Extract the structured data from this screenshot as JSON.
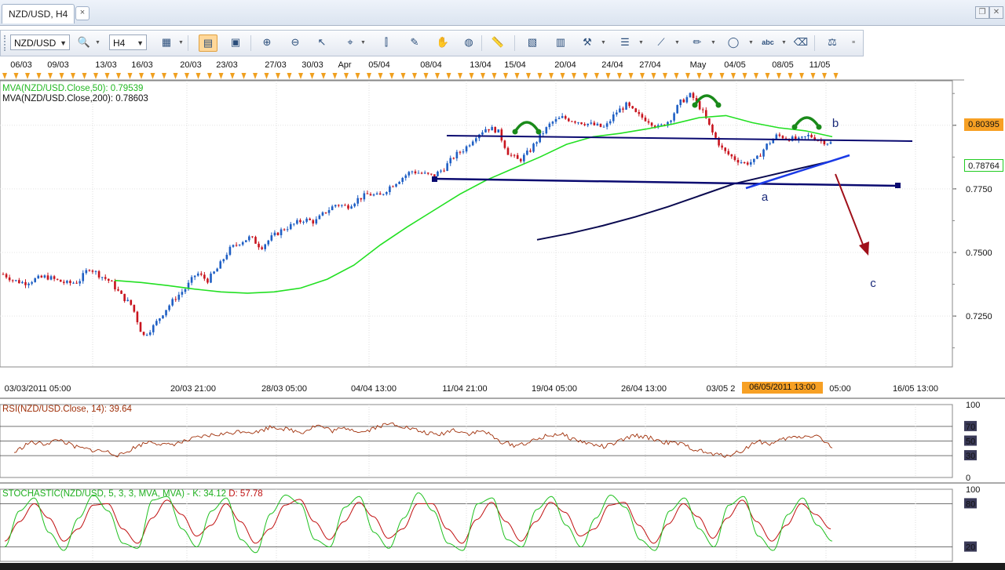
{
  "tab": {
    "title": "NZD/USD, H4",
    "close": "×"
  },
  "window_buttons": [
    "restore",
    "close"
  ],
  "toolbar": {
    "symbol": "NZD/USD",
    "timeframe": "H4",
    "icons": [
      "chart-type-icon",
      "zoom-icon",
      "bar-chart-icon",
      "text-icon",
      "magnify-plus-icon",
      "magnify-minus-icon",
      "cursor-icon",
      "crosshair-icon",
      "indicator-icon",
      "edit-icon",
      "hand-icon",
      "globe-icon",
      "ruler-icon",
      "image-icon",
      "screenshot-icon",
      "tools-icon",
      "layers-icon",
      "trendline-icon",
      "pencil-icon",
      "ellipse-icon",
      "text-abc-icon",
      "eraser-icon",
      "objects-icon"
    ]
  },
  "colors": {
    "up": "#1f5fc4",
    "down": "#c8141e",
    "ma50": "#22e022",
    "ma200": "#0a0a50",
    "trend": "#0a0a70",
    "wedge": "#1a3ae6",
    "arrow": "#a0101a",
    "head": "#1a8a1a",
    "rsi": "#a0300a",
    "stoch_k": "#20c020",
    "stoch_d": "#c01010",
    "highlight": "#f7a024"
  },
  "chart_data": [
    {
      "type": "candlestick",
      "title": "NZD/USD, H4",
      "x_labels_top": [
        "06/03",
        "09/03",
        "13/03",
        "16/03",
        "20/03",
        "23/03",
        "27/03",
        "30/03",
        "Apr",
        "05/04",
        "08/04",
        "13/04",
        "15/04",
        "20/04",
        "24/04",
        "27/04",
        "May",
        "04/05",
        "08/05",
        "11/05"
      ],
      "x_labels_bottom": [
        "03/03/2011 05:00",
        "20/03 21:00",
        "28/03 05:00",
        "04/04 13:00",
        "11/04 21:00",
        "19/04 05:00",
        "26/04 13:00",
        "03/05 2",
        "06/05/2011 13:00",
        "05:00",
        "16/05 13:00"
      ],
      "y_ticks": [
        "0.8000",
        "0.7750",
        "0.7500",
        "0.7250"
      ],
      "ylim": [
        0.705,
        0.8175
      ],
      "price_labels": [
        "0.80395",
        "0.78764"
      ],
      "series": [
        {
          "name": "MVA(NZD/USD.Close,50): 0.79539",
          "kind": "ma",
          "values": [
            0.739,
            0.7382,
            0.737,
            0.7356,
            0.7345,
            0.734,
            0.7345,
            0.736,
            0.7395,
            0.745,
            0.753,
            0.76,
            0.7665,
            0.773,
            0.7785,
            0.783,
            0.7875,
            0.7925,
            0.7955,
            0.7968,
            0.7985,
            0.8005,
            0.803,
            0.8038,
            0.801,
            0.799,
            0.7978,
            0.7955
          ]
        },
        {
          "name": "MVA(NZD/USD.Close,200): 0.78603",
          "kind": "ma",
          "values": [
            0.755,
            0.7575,
            0.7605,
            0.764,
            0.768,
            0.7725,
            0.777,
            0.78,
            0.783,
            0.786
          ]
        }
      ],
      "annotations": [
        "a",
        "b",
        "c"
      ],
      "close_path": [
        0.7415,
        0.739,
        0.738,
        0.7395,
        0.7405,
        0.739,
        0.7378,
        0.7385,
        0.744,
        0.741,
        0.7385,
        0.733,
        0.729,
        0.717,
        0.721,
        0.727,
        0.732,
        0.736,
        0.742,
        0.739,
        0.744,
        0.751,
        0.754,
        0.756,
        0.752,
        0.756,
        0.759,
        0.761,
        0.763,
        0.762,
        0.766,
        0.769,
        0.768,
        0.771,
        0.773,
        0.772,
        0.776,
        0.779,
        0.782,
        0.781,
        0.78,
        0.783,
        0.788,
        0.791,
        0.796,
        0.799,
        0.798,
        0.789,
        0.786,
        0.79,
        0.796,
        0.801,
        0.803,
        0.802,
        0.801,
        0.8,
        0.799,
        0.805,
        0.808,
        0.804,
        0.802,
        0.799,
        0.802,
        0.809,
        0.812,
        0.806,
        0.797,
        0.79,
        0.787,
        0.785,
        0.786,
        0.792,
        0.796,
        0.795,
        0.794,
        0.796,
        0.794,
        0.793
      ]
    },
    {
      "type": "line",
      "title": "RSI(NZD/USD.Close, 14): 39.64",
      "ylim": [
        0,
        100
      ],
      "y_ticks": [
        "100",
        "70",
        "50",
        "30",
        "0"
      ],
      "values": [
        34,
        48,
        46,
        52,
        42,
        38,
        36,
        30,
        42,
        50,
        44,
        48,
        54,
        58,
        60,
        64,
        62,
        70,
        66,
        62,
        72,
        64,
        68,
        62,
        70,
        74,
        68,
        62,
        58,
        66,
        60,
        64,
        50,
        44,
        48,
        56,
        60,
        52,
        46,
        42,
        50,
        58,
        54,
        48,
        46,
        38,
        32,
        30,
        36,
        50,
        46,
        54,
        56,
        58,
        40
      ]
    },
    {
      "type": "line",
      "title": "STOCHASTIC(NZD/USD, 5, 3, 3, MVA, MVA)",
      "k_label": "K: 34.12",
      "d_label": "D: 57.78",
      "ylim": [
        0,
        100
      ],
      "y_ticks": [
        "100",
        "80",
        "20"
      ],
      "series": [
        {
          "name": "K",
          "values": [
            20,
            70,
            88,
            40,
            15,
            60,
            92,
            70,
            25,
            18,
            85,
            90,
            45,
            20,
            70,
            88,
            30,
            12,
            66,
            92,
            80,
            30,
            20,
            75,
            90,
            40,
            18,
            60,
            95,
            70,
            25,
            15,
            80,
            88,
            30,
            20,
            72,
            90,
            50,
            20,
            60,
            92,
            75,
            30,
            15,
            70,
            88,
            45,
            20,
            78,
            90,
            35,
            15,
            65,
            88,
            50,
            28
          ]
        },
        {
          "name": "D",
          "values": [
            28,
            55,
            80,
            60,
            28,
            45,
            78,
            80,
            45,
            25,
            60,
            85,
            65,
            35,
            50,
            80,
            55,
            25,
            45,
            78,
            86,
            55,
            30,
            55,
            82,
            62,
            32,
            45,
            80,
            80,
            45,
            25,
            58,
            82,
            55,
            28,
            55,
            82,
            68,
            35,
            45,
            78,
            82,
            50,
            25,
            52,
            80,
            62,
            32,
            60,
            85,
            55,
            28,
            50,
            80,
            65,
            45
          ]
        }
      ]
    }
  ]
}
